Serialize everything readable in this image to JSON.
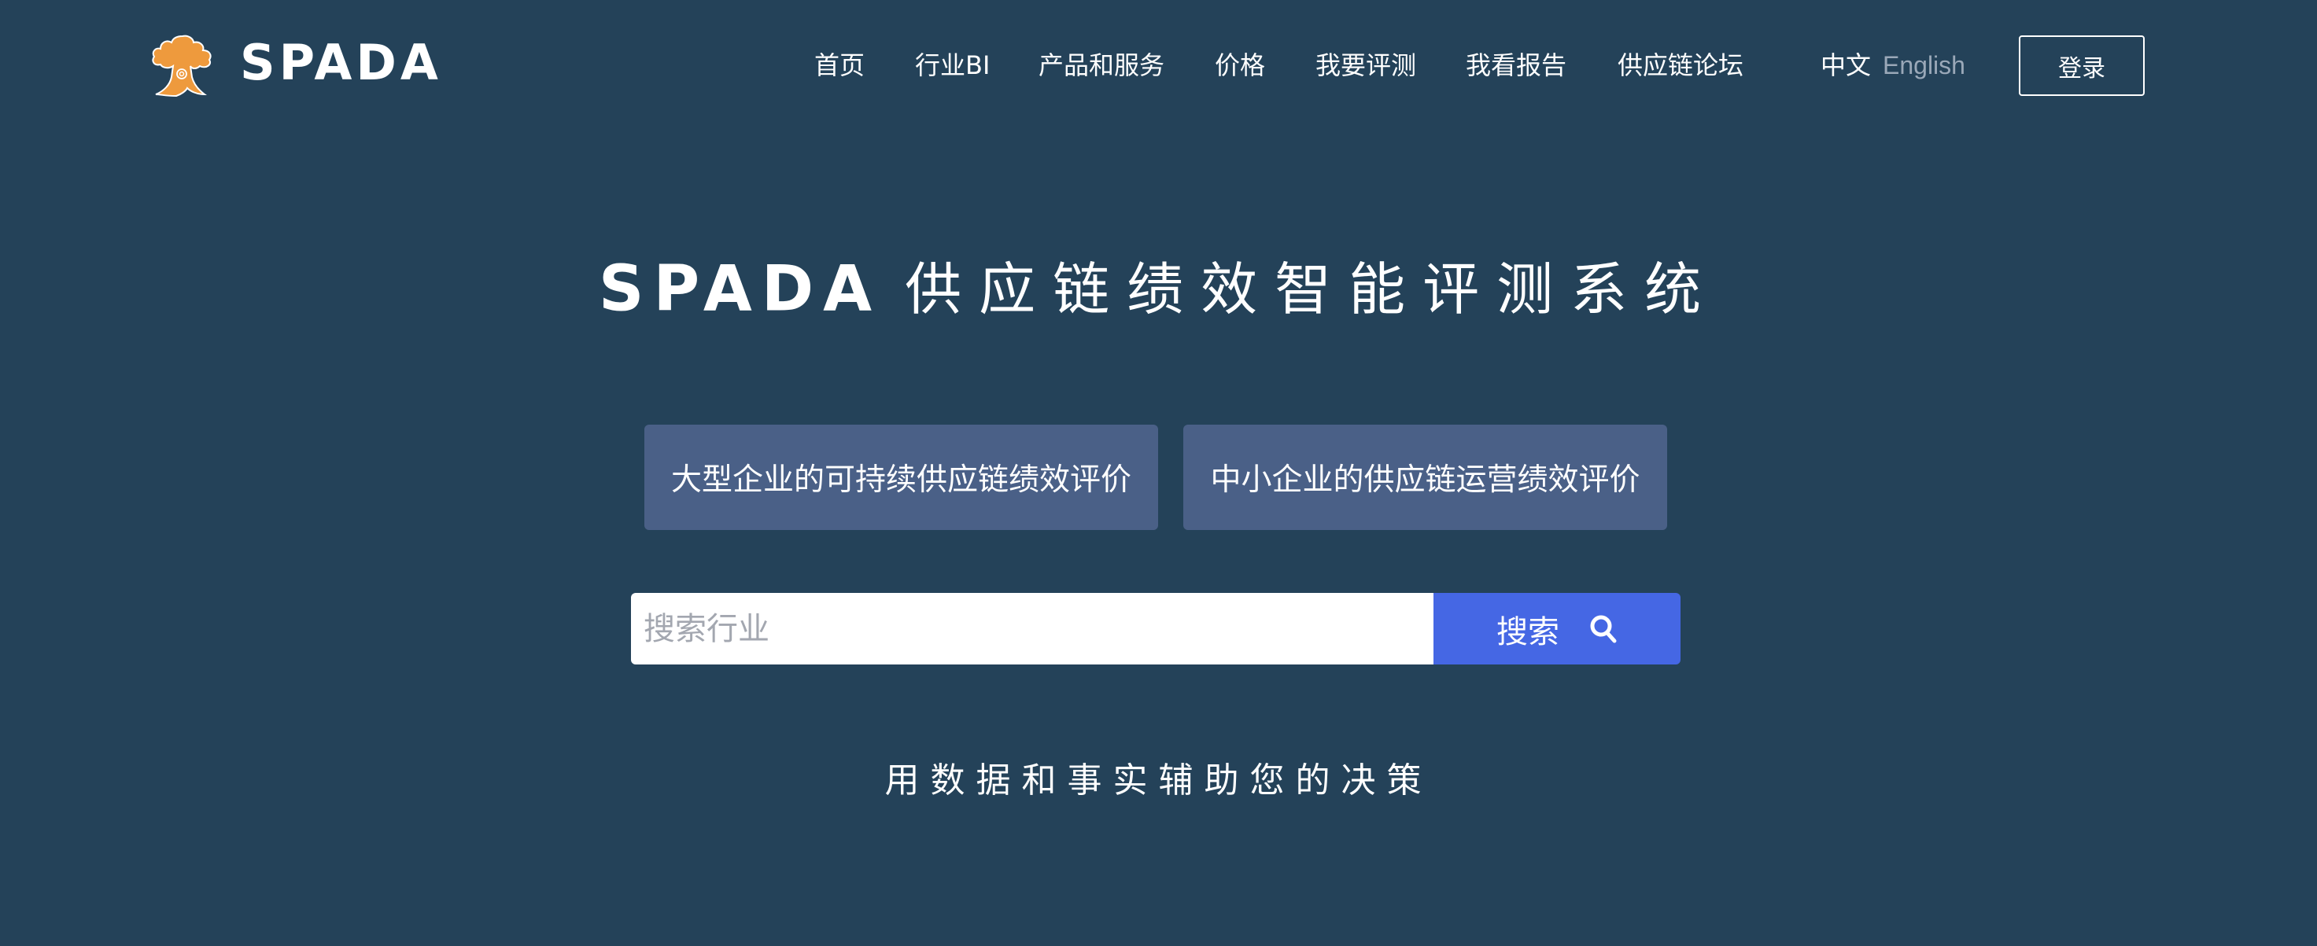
{
  "header": {
    "brand": "SPADA",
    "logo_icon": "tree-at-logo-icon",
    "nav": [
      {
        "label": "首页"
      },
      {
        "label": "行业BI"
      },
      {
        "label": "产品和服务"
      },
      {
        "label": "价格"
      },
      {
        "label": "我要评测"
      },
      {
        "label": "我看报告"
      },
      {
        "label": "供应链论坛"
      }
    ],
    "lang_zh": "中文",
    "lang_en": "English",
    "login_label": "登录"
  },
  "hero": {
    "brand": "SPADA",
    "title": "供应链绩效智能评测系统",
    "cards": [
      {
        "label": "大型企业的可持续供应链绩效评价"
      },
      {
        "label": "中小企业的供应链运营绩效评价"
      }
    ],
    "search": {
      "placeholder": "搜索行业",
      "value": "",
      "button_label": "搜索",
      "button_icon": "search-icon"
    },
    "tagline": "用数据和事实辅助您的决策"
  },
  "colors": {
    "background": "#244259",
    "card": "#4a6087",
    "accent": "#4567e4",
    "logo": "#ee9a3d",
    "lang_inactive": "#9aa8b8"
  }
}
